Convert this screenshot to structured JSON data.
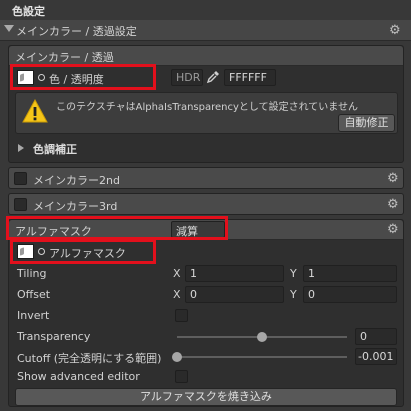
{
  "title": "色設定",
  "section": {
    "label": "メインカラー / 透過設定"
  },
  "main_color": {
    "header": "メインカラー / 透過",
    "color_label": "色 / 透明度",
    "hdr_label": "HDR",
    "hex_value": "FFFFFF",
    "warning_text": "このテクスチャはAlphaIsTransparencyとして設定されていません",
    "fix_button": "自動修正",
    "color_correction": "色調補正"
  },
  "main_color_2nd": {
    "label": "メインカラー2nd"
  },
  "main_color_3rd": {
    "label": "メインカラー3rd"
  },
  "alpha_mask": {
    "header": "アルファマスク",
    "mode_value": "減算",
    "texture_label": "アルファマスク",
    "tiling_label": "Tiling",
    "tiling_x": "1",
    "tiling_y": "1",
    "offset_label": "Offset",
    "offset_x": "0",
    "offset_y": "0",
    "x_label": "X",
    "y_label": "Y",
    "invert_label": "Invert",
    "transparency_label": "Transparency",
    "transparency_value": "0",
    "transparency_fraction": 0.5,
    "cutoff_label": "Cutoff (完全透明にする範囲)",
    "cutoff_value": "-0.001",
    "cutoff_fraction": 0.0,
    "advanced_label": "Show advanced editor",
    "bake_button": "アルファマスクを焼き込み"
  },
  "icons": {
    "gear": "gear-icon",
    "warning": "warning-icon",
    "eyedropper": "eyedropper-icon"
  },
  "colors": {
    "highlight": "#e3101c",
    "warning": "#f5c518"
  }
}
